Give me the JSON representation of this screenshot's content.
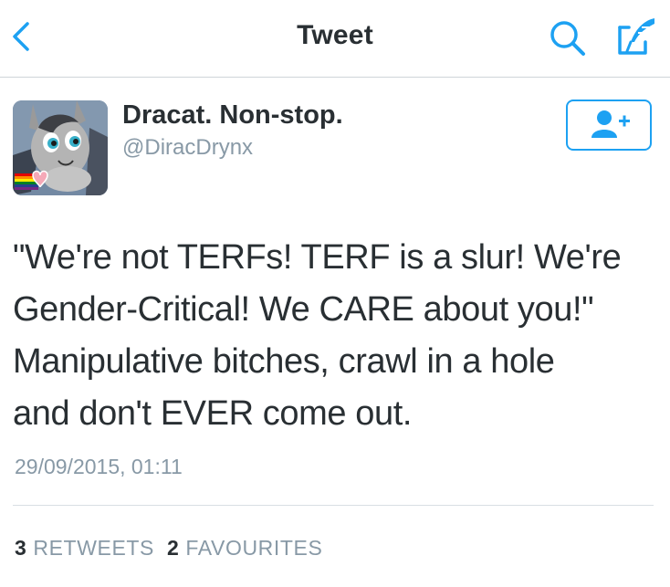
{
  "nav": {
    "title": "Tweet",
    "back_icon": "chevron-left-icon",
    "search_icon": "search-icon",
    "compose_icon": "compose-tweet-icon",
    "accent_color": "#1da1f2"
  },
  "author": {
    "display_name": "Dracat. Non-stop.",
    "handle": "@DiracDrynx",
    "avatar_icon": "avatar-image",
    "follow_icon": "follow-user-icon"
  },
  "tweet": {
    "lines": [
      "\"We're not TERFs! TERF is a slur!  We're",
      "Gender-Critical! We CARE about you!\"",
      "Manipulative bitches, crawl in a hole",
      "and don't EVER come out."
    ],
    "timestamp": "29/09/2015, 01:11"
  },
  "stats": {
    "retweets_count": "3",
    "retweets_label": "RETWEETS",
    "favourites_count": "2",
    "favourites_label": "FAVOURITES"
  }
}
